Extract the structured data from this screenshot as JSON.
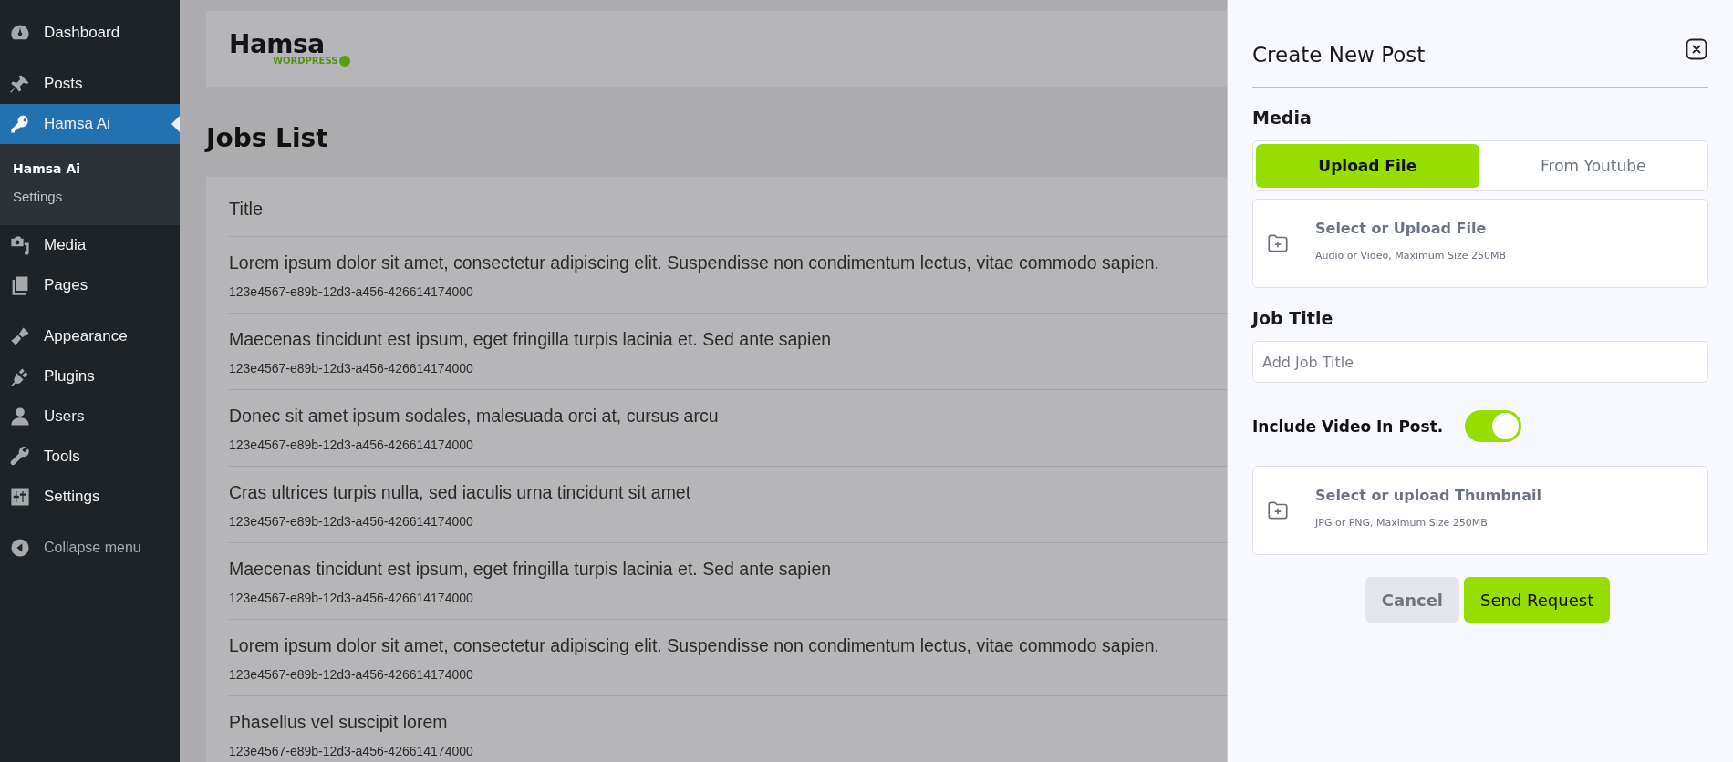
{
  "sidebar": {
    "items": [
      {
        "label": "Dashboard",
        "selected": false
      },
      {
        "label": "Posts",
        "selected": false
      },
      {
        "label": "Hamsa Ai",
        "selected": true,
        "children": [
          {
            "label": "Hamsa Ai",
            "selected": true
          },
          {
            "label": "Settings",
            "selected": false
          }
        ]
      },
      {
        "label": "Media",
        "selected": false
      },
      {
        "label": "Pages",
        "selected": false
      },
      {
        "label": "Appearance",
        "selected": false
      },
      {
        "label": "Plugins",
        "selected": false
      },
      {
        "label": "Users",
        "selected": false
      },
      {
        "label": "Tools",
        "selected": false
      },
      {
        "label": "Settings",
        "selected": false
      }
    ],
    "collapse_label": "Collapse menu"
  },
  "header": {
    "logo_name": "Hamsa",
    "logo_tagline": "WORDPRESS"
  },
  "page_title": "Jobs List",
  "table": {
    "columns": [
      "Title"
    ],
    "rows": [
      {
        "title": "Lorem ipsum dolor sit amet, consectetur adipiscing elit. Suspendisse non condimentum lectus, vitae commodo sapien.",
        "id": "123e4567-e89b-12d3-a456-426614174000"
      },
      {
        "title": "Maecenas tincidunt est ipsum, eget fringilla turpis lacinia et. Sed ante sapien",
        "id": "123e4567-e89b-12d3-a456-426614174000"
      },
      {
        "title": "Donec sit amet ipsum sodales, malesuada orci at, cursus arcu",
        "id": "123e4567-e89b-12d3-a456-426614174000"
      },
      {
        "title": "Cras ultrices turpis nulla, sed iaculis urna tincidunt sit amet",
        "id": "123e4567-e89b-12d3-a456-426614174000"
      },
      {
        "title": "Maecenas tincidunt est ipsum, eget fringilla turpis lacinia et. Sed ante sapien",
        "id": "123e4567-e89b-12d3-a456-426614174000"
      },
      {
        "title": "Lorem ipsum dolor sit amet, consectetur adipiscing elit. Suspendisse non condimentum lectus, vitae commodo sapien.",
        "id": "123e4567-e89b-12d3-a456-426614174000"
      },
      {
        "title": "Phasellus vel suscipit lorem",
        "id": "123e4567-e89b-12d3-a456-426614174000"
      }
    ]
  },
  "panel": {
    "title": "Create New Post",
    "media_label": "Media",
    "media_tabs": [
      {
        "label": "Upload File",
        "selected": true
      },
      {
        "label": "From Youtube",
        "selected": false
      }
    ],
    "file_upload": {
      "title": "Select or Upload File",
      "hint": "Audio or Video, Maximum Size 250MB"
    },
    "job_title": {
      "label": "Job Title",
      "placeholder": "Add Job Title"
    },
    "include_video": {
      "label": "Include Video In Post.",
      "on": true
    },
    "thumbnail_upload": {
      "title": "Select or upload Thumbnail",
      "hint": "JPG or PNG, Maximum Size 250MB"
    },
    "buttons": [
      {
        "label": "Cancel",
        "kind": "secondary"
      },
      {
        "label": "Send Request",
        "kind": "primary"
      }
    ]
  }
}
